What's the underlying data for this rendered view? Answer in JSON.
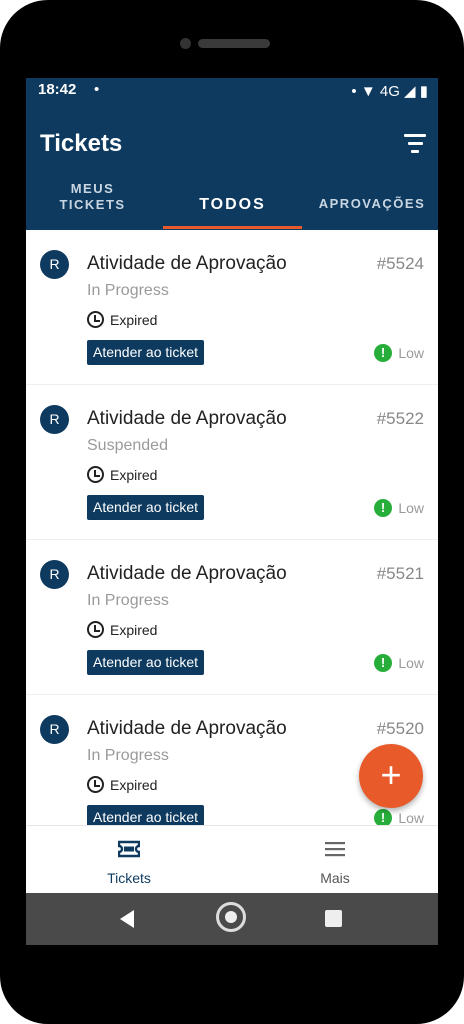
{
  "status_bar": {
    "time": "18:42",
    "dot": "•",
    "icons": "• ▼ 4G ◢ ▮"
  },
  "app_bar": {
    "title": "Tickets"
  },
  "tabs": [
    {
      "label": "MEUS\nTICKETS"
    },
    {
      "label": "TODOS"
    },
    {
      "label": "APROVAÇÕES"
    }
  ],
  "tickets": [
    {
      "avatar": "R",
      "title": "Atividade de Aprovação",
      "number": "#5524",
      "status": "In Progress",
      "expiry": "Expired",
      "action": "Atender ao ticket",
      "priority_icon": "!",
      "priority": "Low"
    },
    {
      "avatar": "R",
      "title": "Atividade de Aprovação",
      "number": "#5522",
      "status": "Suspended",
      "expiry": "Expired",
      "action": "Atender ao ticket",
      "priority_icon": "!",
      "priority": "Low"
    },
    {
      "avatar": "R",
      "title": "Atividade de Aprovação",
      "number": "#5521",
      "status": "In Progress",
      "expiry": "Expired",
      "action": "Atender ao ticket",
      "priority_icon": "!",
      "priority": "Low"
    },
    {
      "avatar": "R",
      "title": "Atividade de Aprovação",
      "number": "#5520",
      "status": "In Progress",
      "expiry": "Expired",
      "action": "Atender ao ticket",
      "priority_icon": "!",
      "priority": "Low"
    }
  ],
  "fab": {
    "label": "+"
  },
  "bottom_nav": [
    {
      "label": "Tickets",
      "icon": "ticket-icon"
    },
    {
      "label": "Mais",
      "icon": "menu-icon"
    }
  ],
  "colors": {
    "primary": "#0e3a5f",
    "accent": "#e85a2a",
    "priority_low": "#27ae3a"
  }
}
